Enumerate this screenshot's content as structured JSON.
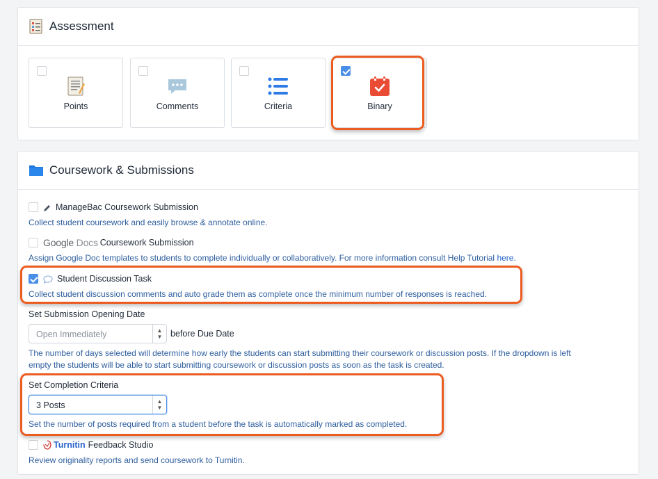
{
  "assessment": {
    "title": "Assessment",
    "cards": [
      {
        "label": "Points",
        "checked": false
      },
      {
        "label": "Comments",
        "checked": false
      },
      {
        "label": "Criteria",
        "checked": false
      },
      {
        "label": "Binary",
        "checked": true
      }
    ]
  },
  "coursework": {
    "title": "Coursework & Submissions",
    "managebac": {
      "title": "ManageBac Coursework Submission",
      "desc": "Collect student coursework and easily browse & annotate online.",
      "checked": false
    },
    "gdocs": {
      "logo_google": "Google",
      "logo_docs": "Docs",
      "title": "Coursework Submission",
      "desc": "Assign Google Doc templates to students to complete individually or collaboratively. For more information consult Help Tutorial",
      "link": "here",
      "desc_end": ".",
      "checked": false
    },
    "discussion": {
      "title": "Student Discussion Task",
      "desc": "Collect student discussion comments and auto grade them as complete once the minimum number of responses is reached.",
      "checked": true
    },
    "opening": {
      "label": "Set Submission Opening Date",
      "placeholder": "Open Immediately",
      "suffix": "before Due Date",
      "desc_line1": "The number of days selected will determine how early the students can start submitting their coursework or discussion posts. If the dropdown is left",
      "desc_line2": "empty the students will be able to start submitting coursework or discussion posts as soon as the task is created."
    },
    "completion": {
      "label": "Set Completion Criteria",
      "value": "3 Posts",
      "desc": "Set the number of posts required from a student before the task is automatically marked as completed."
    },
    "turnitin": {
      "brand": "Turnitin",
      "title": "Feedback Studio",
      "desc": "Review originality reports and send coursework to Turnitin.",
      "checked": false
    }
  },
  "colors": {
    "accent": "#4a8fe7",
    "highlight": "#ec5b1f",
    "binary_icon": "#ea4b35",
    "link": "#2563c9"
  }
}
